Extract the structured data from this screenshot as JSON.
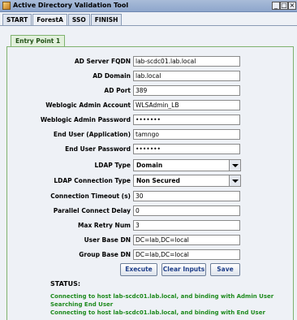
{
  "window": {
    "title": "Active Directory Validation Tool"
  },
  "tabs": [
    {
      "label": "START"
    },
    {
      "label": "ForestA"
    },
    {
      "label": "SSO"
    },
    {
      "label": "FINISH"
    }
  ],
  "entry_tab": "Entry Point 1",
  "fields": [
    {
      "label": "AD Server FQDN",
      "value": "lab-scdc01.lab.local"
    },
    {
      "label": "AD Domain",
      "value": "lab.local"
    },
    {
      "label": "AD Port",
      "value": "389"
    },
    {
      "label": "Weblogic Admin Account",
      "value": "WLSAdmin_LB"
    },
    {
      "label": "Weblogic Admin Password",
      "value": "•••••••"
    },
    {
      "label": "End User (Application)",
      "value": "tamngo"
    },
    {
      "label": "End User Password",
      "value": "•••••••"
    },
    {
      "label": "LDAP Type",
      "value": "Domain"
    },
    {
      "label": "LDAP Connection Type",
      "value": "Non Secured"
    },
    {
      "label": "Connection Timeout (s)",
      "value": "30"
    },
    {
      "label": "Parallel Connect Delay",
      "value": "0"
    },
    {
      "label": "Max Retry Num",
      "value": "3"
    },
    {
      "label": "User Base DN",
      "value": "DC=lab,DC=local"
    },
    {
      "label": "Group Base DN",
      "value": "DC=lab,DC=local"
    }
  ],
  "buttons": {
    "execute": "Execute",
    "clear": "Clear Inputs",
    "save": "Save"
  },
  "status": {
    "label": "STATUS:",
    "lines": [
      "Connecting to host lab-scdc01.lab.local, and binding with Admin User",
      "Searching End User",
      "Connecting to host lab-scdc01.lab.local, and binding with End User"
    ]
  },
  "colors": {
    "status_text": "#1e8a1e",
    "accent": "#7fb26e"
  }
}
